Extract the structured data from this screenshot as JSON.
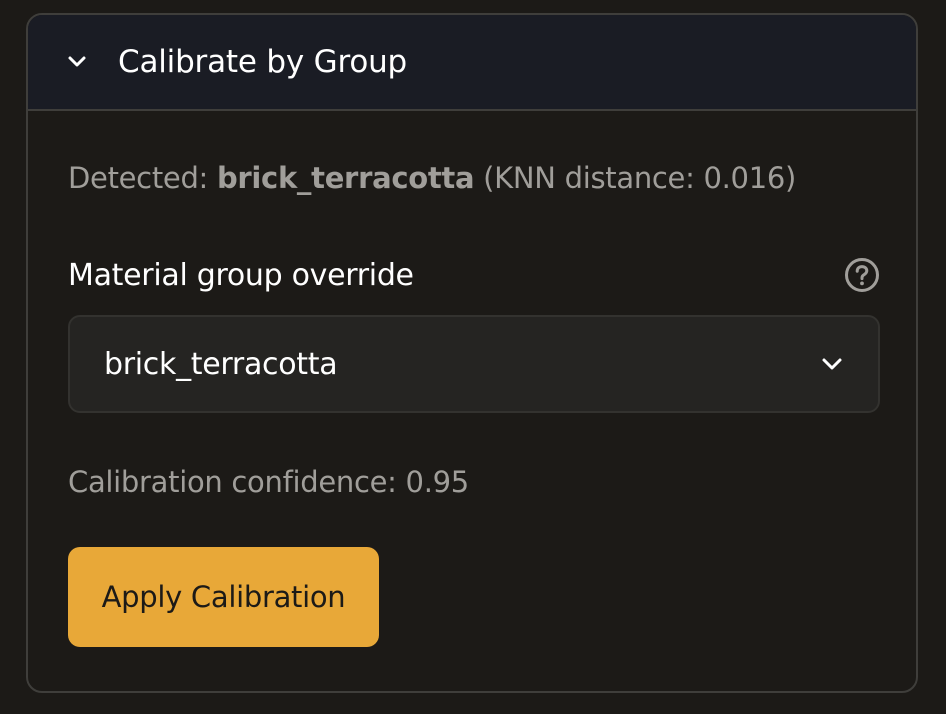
{
  "panel": {
    "title": "Calibrate by Group",
    "collapse_icon": "chevron-down-icon"
  },
  "detection": {
    "prefix": "Detected: ",
    "group": "brick_terracotta",
    "distance_text": " (KNN distance: 0.016)"
  },
  "override": {
    "label": "Material group override",
    "help_icon": "help-circle-icon",
    "selected_value": "brick_terracotta",
    "dropdown_icon": "chevron-down-icon"
  },
  "confidence": {
    "text": "Calibration confidence: 0.95"
  },
  "actions": {
    "apply_label": "Apply Calibration"
  },
  "colors": {
    "background": "#1c1a17",
    "header_background": "#1a1c24",
    "accent": "#e8a838",
    "muted_text": "#a09e9a",
    "text": "#ffffff"
  }
}
